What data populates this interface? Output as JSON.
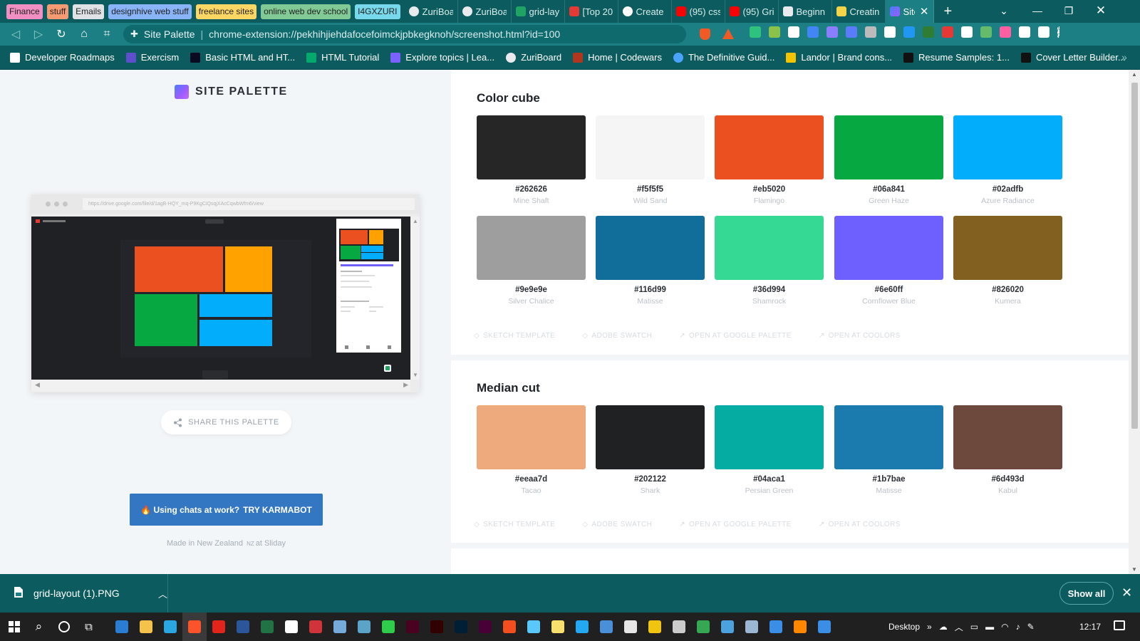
{
  "browser": {
    "tab_groups": [
      {
        "label": "Finance",
        "color": "#f28fc2"
      },
      {
        "label": "stuff",
        "color": "#f59b74"
      },
      {
        "label": "Emails",
        "color": "#dfe3e6"
      },
      {
        "label": "designhive web stuff",
        "color": "#8ab4f8"
      },
      {
        "label": "freelance sites",
        "color": "#fdd663"
      },
      {
        "label": "online web dev school",
        "color": "#81c995"
      },
      {
        "label": "I4GXZURI",
        "color": "#78d9ec"
      }
    ],
    "tabs": [
      {
        "title": "ZuriBoa",
        "icon": "zuri-icon",
        "color": "#e8eaed"
      },
      {
        "title": "ZuriBoa",
        "icon": "zuri-icon",
        "color": "#e8eaed"
      },
      {
        "title": "grid-lay",
        "icon": "google-drive-icon",
        "color": "#1fa463"
      },
      {
        "title": "[Top 20",
        "icon": "codewars-icon",
        "color": "#e53935"
      },
      {
        "title": "Create",
        "icon": "github-icon",
        "color": "#ffffff"
      },
      {
        "title": "(95) css",
        "icon": "youtube-icon",
        "color": "#ff0000"
      },
      {
        "title": "(95) Gri",
        "icon": "youtube-icon",
        "color": "#ff0000"
      },
      {
        "title": "Beginn",
        "icon": "freecodecamp-icon",
        "color": "#e8eaed"
      },
      {
        "title": "Creatin",
        "icon": "codecademy-icon",
        "color": "#f5d547"
      }
    ],
    "active_tab": {
      "title": "Site",
      "icon": "site-palette-icon"
    },
    "omnibox": {
      "site_label": "Site Palette",
      "url": "chrome-extension://pekhihjiehdafocefoimckjpbkegknoh/screenshot.html?id=100"
    },
    "bookmarks": [
      {
        "label": "Developer Roadmaps",
        "icon": "roadmap-icon",
        "color": "#ffffff"
      },
      {
        "label": "Exercism",
        "icon": "exercism-icon",
        "color": "#604fcd"
      },
      {
        "label": "Basic HTML and HT...",
        "icon": "freecodecamp-icon",
        "color": "#0a0a23"
      },
      {
        "label": "HTML Tutorial",
        "icon": "w3schools-icon",
        "color": "#04aa6d"
      },
      {
        "label": "Explore topics | Lea...",
        "icon": "explore-icon",
        "color": "#7b61ff"
      },
      {
        "label": "ZuriBoard",
        "icon": "zuri-icon",
        "color": "#e8eaed"
      },
      {
        "label": "Home | Codewars",
        "icon": "codewars-icon",
        "color": "#b1361e"
      },
      {
        "label": "The Definitive Guid...",
        "icon": "gear-icon",
        "color": "#4aa3ff"
      },
      {
        "label": "Landor | Brand cons...",
        "icon": "landor-icon",
        "color": "#f5c400"
      },
      {
        "label": "Resume Samples: 1...",
        "icon": "resume-icon",
        "color": "#111111"
      },
      {
        "label": "Cover Letter Builder...",
        "icon": "cover-letter-icon",
        "color": "#111111"
      }
    ]
  },
  "app": {
    "brand": "SITE PALETTE",
    "screenshot_url": "https://drive.google.com/file/d/1agB-HQY_mq-P9KgCiQsqjXAcCqwbWfm6/view",
    "share_label": "SHARE THIS PALETTE",
    "ad_text": "🔥 Using chats at work?",
    "ad_cta": "TRY KARMABOT",
    "made_in": "Made in New Zealand",
    "made_nz": "NZ",
    "made_by": "at Sliday"
  },
  "sections": [
    {
      "title": "Color cube",
      "swatches": [
        {
          "hex": "#262626",
          "name": "Mine Shaft"
        },
        {
          "hex": "#f5f5f5",
          "name": "Wild Sand"
        },
        {
          "hex": "#eb5020",
          "name": "Flamingo"
        },
        {
          "hex": "#06a841",
          "name": "Green Haze"
        },
        {
          "hex": "#02adfb",
          "name": "Azure Radiance"
        },
        {
          "hex": "#9e9e9e",
          "name": "Silver Chalice"
        },
        {
          "hex": "#116d99",
          "name": "Matisse"
        },
        {
          "hex": "#36d994",
          "name": "Shamrock"
        },
        {
          "hex": "#6e60ff",
          "name": "Cornflower Blue"
        },
        {
          "hex": "#826020",
          "name": "Kumera"
        }
      ]
    },
    {
      "title": "Median cut",
      "swatches": [
        {
          "hex": "#eeaa7d",
          "name": "Tacao"
        },
        {
          "hex": "#202122",
          "name": "Shark"
        },
        {
          "hex": "#04aca1",
          "name": "Persian Green"
        },
        {
          "hex": "#1b7bae",
          "name": "Matisse"
        },
        {
          "hex": "#6d493d",
          "name": "Kabul"
        }
      ]
    }
  ],
  "actions": [
    "SKETCH TEMPLATE",
    "ADOBE SWATCH",
    "OPEN AT GOOGLE PALETTE",
    "OPEN AT COOLORS"
  ],
  "downloads": {
    "file": "grid-layout (1).PNG",
    "show_all": "Show all"
  },
  "taskbar": {
    "apps": [
      {
        "name": "calendar-app",
        "color": "#2b7cd3"
      },
      {
        "name": "file-explorer",
        "color": "#f3c34a"
      },
      {
        "name": "edge",
        "color": "#2aa7e0"
      },
      {
        "name": "brave",
        "color": "#fb542b"
      },
      {
        "name": "acrobat",
        "color": "#e1251b"
      },
      {
        "name": "word",
        "color": "#2b579a"
      },
      {
        "name": "excel",
        "color": "#217346"
      },
      {
        "name": "notion",
        "color": "#ffffff"
      },
      {
        "name": "access",
        "color": "#d13438"
      },
      {
        "name": "rstudio",
        "color": "#75aadb"
      },
      {
        "name": "teams-chat",
        "color": "#5aa5c7"
      },
      {
        "name": "sublime",
        "color": "#2fcc4c"
      },
      {
        "name": "indesign",
        "color": "#49021f"
      },
      {
        "name": "illustrator",
        "color": "#330000"
      },
      {
        "name": "photoshop",
        "color": "#001e36"
      },
      {
        "name": "xd",
        "color": "#470137"
      },
      {
        "name": "figma",
        "color": "#f24e1e"
      },
      {
        "name": "notepad",
        "color": "#5ac8fa"
      },
      {
        "name": "sticky-notes",
        "color": "#f7e06b"
      },
      {
        "name": "vscode",
        "color": "#23a9f2"
      },
      {
        "name": "app-20",
        "color": "#4a90d9"
      },
      {
        "name": "app-21",
        "color": "#e6e6e6"
      },
      {
        "name": "git",
        "color": "#f1c40f"
      },
      {
        "name": "terminal",
        "color": "#cccccc"
      },
      {
        "name": "chrome",
        "color": "#34a853"
      },
      {
        "name": "app-25",
        "color": "#4aa3df"
      },
      {
        "name": "app-26",
        "color": "#9bb7d4"
      },
      {
        "name": "app-27",
        "color": "#3a8ee6"
      },
      {
        "name": "vlc",
        "color": "#ff8800"
      },
      {
        "name": "app-29",
        "color": "#3a8ee6"
      }
    ],
    "desktop_label": "Desktop",
    "time": "12:17"
  }
}
